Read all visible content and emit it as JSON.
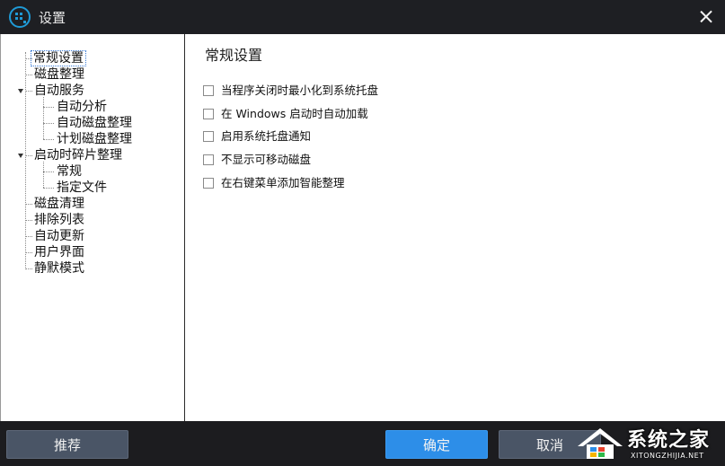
{
  "window": {
    "title": "设置"
  },
  "tree": {
    "items": [
      {
        "label": "常规设置"
      },
      {
        "label": "磁盘整理"
      },
      {
        "label": "自动服务"
      },
      {
        "label": "自动分析"
      },
      {
        "label": "自动磁盘整理"
      },
      {
        "label": "计划磁盘整理"
      },
      {
        "label": "启动时碎片整理"
      },
      {
        "label": "常规"
      },
      {
        "label": "指定文件"
      },
      {
        "label": "磁盘清理"
      },
      {
        "label": "排除列表"
      },
      {
        "label": "自动更新"
      },
      {
        "label": "用户界面"
      },
      {
        "label": "静默模式"
      }
    ]
  },
  "panel": {
    "title": "常规设置",
    "options": [
      {
        "label": "当程序关闭时最小化到系统托盘",
        "checked": false
      },
      {
        "label": "在 Windows 启动时自动加载",
        "checked": false
      },
      {
        "label": "启用系统托盘通知",
        "checked": false
      },
      {
        "label": "不显示可移动磁盘",
        "checked": false
      },
      {
        "label": "在右键菜单添加智能整理",
        "checked": false
      }
    ]
  },
  "buttons": {
    "recommend": "推荐",
    "ok": "确定",
    "cancel": "取消"
  },
  "watermark": {
    "text": "系统之家",
    "sub": "XITONGZHIJIA.NET"
  }
}
